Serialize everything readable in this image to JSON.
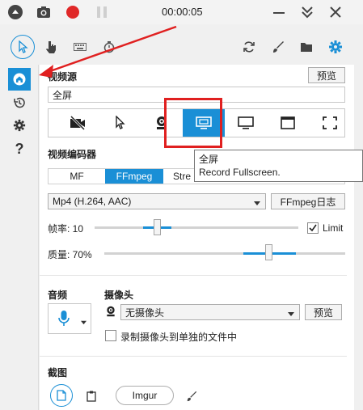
{
  "titlebar": {
    "timer": "00:00:05"
  },
  "source": {
    "label": "视频源",
    "preview": "预览",
    "value": "全屏"
  },
  "encoder": {
    "label": "视频编码器",
    "tabs": [
      "MF",
      "FFmpeg",
      "Stre"
    ],
    "format": "Mp4 (H.264, AAC)",
    "log": "FFmpeg日志",
    "fps_label": "帧率: 10",
    "limit_label": "Limit",
    "quality_label": "质量: 70%",
    "fps_value": 10,
    "quality_value": 70
  },
  "audio": {
    "label": "音频"
  },
  "webcam": {
    "label": "摄像头",
    "value": "无摄像头",
    "preview": "预览",
    "separate_label": "录制摄像头到单独的文件中"
  },
  "screenshot": {
    "label": "截图",
    "imgur": "Imgur"
  },
  "tooltip": {
    "title": "全屏",
    "desc": "Record Fullscreen."
  },
  "colors": {
    "accent": "#1a8fd6",
    "record": "#e02828",
    "annotation": "#e02020"
  }
}
